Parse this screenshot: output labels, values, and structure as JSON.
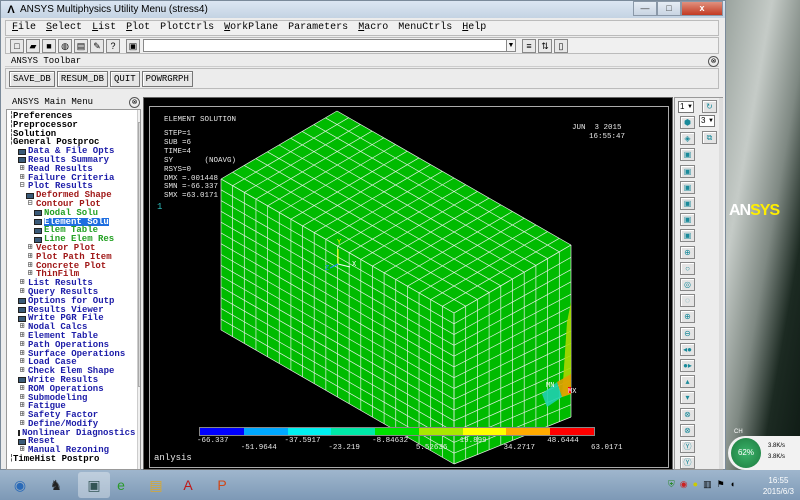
{
  "window": {
    "title": "ANSYS Multiphysics Utility Menu (stress4)",
    "minimize": "—",
    "maximize": "□",
    "close": "x"
  },
  "menu": [
    {
      "k": "F",
      "r": "ile"
    },
    {
      "k": "S",
      "r": "elect"
    },
    {
      "k": "L",
      "r": "ist"
    },
    {
      "k": "P",
      "r": "lot"
    },
    {
      "k": "",
      "r": "PlotCtrls"
    },
    {
      "k": "W",
      "r": "orkPlane"
    },
    {
      "k": "",
      "r": "Parameters"
    },
    {
      "k": "M",
      "r": "acro"
    },
    {
      "k": "",
      "r": "MenuCtrls"
    },
    {
      "k": "H",
      "r": "elp"
    }
  ],
  "toolbar_icons": [
    "new-file",
    "open-folder",
    "save",
    "report",
    "print",
    "snapshot",
    "help-hint"
  ],
  "command_input": {
    "value": ""
  },
  "ansys_toolbar": {
    "label": "ANSYS Toolbar",
    "buttons": [
      "SAVE_DB",
      "RESUM_DB",
      "QUIT",
      "POWRGRPH"
    ]
  },
  "main_menu": {
    "title": "ANSYS Main Menu",
    "items": [
      {
        "l": 0,
        "p": "▪",
        "t": "Preferences"
      },
      {
        "l": 0,
        "p": "▪",
        "t": "Preprocessor"
      },
      {
        "l": 0,
        "p": "▪",
        "t": "Solution"
      },
      {
        "l": 0,
        "p": "▪",
        "t": "General Postproc"
      },
      {
        "l": 1,
        "p": "i",
        "t": "Data & File Opts"
      },
      {
        "l": 1,
        "p": "i",
        "t": "Results Summary"
      },
      {
        "l": 1,
        "p": "⊞",
        "t": "Read Results"
      },
      {
        "l": 1,
        "p": "⊞",
        "t": "Failure Criteria"
      },
      {
        "l": 1,
        "p": "⊟",
        "t": "Plot Results"
      },
      {
        "l": 2,
        "p": "i",
        "t": "Deformed Shape"
      },
      {
        "l": 2,
        "p": "⊟",
        "t": "Contour Plot"
      },
      {
        "l": 3,
        "p": "i",
        "t": "Nodal Solu"
      },
      {
        "l": 3,
        "p": "i",
        "t": "Element Solu",
        "sel": true
      },
      {
        "l": 3,
        "p": "i",
        "t": "Elem Table"
      },
      {
        "l": 3,
        "p": "i",
        "t": "Line Elem Res"
      },
      {
        "l": 2,
        "p": "⊞",
        "t": "Vector Plot"
      },
      {
        "l": 2,
        "p": "⊞",
        "t": "Plot Path Item"
      },
      {
        "l": 2,
        "p": "⊞",
        "t": "Concrete Plot"
      },
      {
        "l": 2,
        "p": "⊞",
        "t": "ThinFilm"
      },
      {
        "l": 1,
        "p": "⊞",
        "t": "List Results"
      },
      {
        "l": 1,
        "p": "⊞",
        "t": "Query Results"
      },
      {
        "l": 1,
        "p": "i",
        "t": "Options for Outp"
      },
      {
        "l": 1,
        "p": "i",
        "t": "Results Viewer"
      },
      {
        "l": 1,
        "p": "i",
        "t": "Write PGR File"
      },
      {
        "l": 1,
        "p": "⊞",
        "t": "Nodal Calcs"
      },
      {
        "l": 1,
        "p": "⊞",
        "t": "Element Table"
      },
      {
        "l": 1,
        "p": "⊞",
        "t": "Path Operations"
      },
      {
        "l": 1,
        "p": "⊞",
        "t": "Surface Operations"
      },
      {
        "l": 1,
        "p": "⊞",
        "t": "Load Case"
      },
      {
        "l": 1,
        "p": "⊞",
        "t": "Check Elem Shape"
      },
      {
        "l": 1,
        "p": "i",
        "t": "Write Results"
      },
      {
        "l": 1,
        "p": "⊞",
        "t": "ROM Operations"
      },
      {
        "l": 1,
        "p": "⊞",
        "t": "Submodeling"
      },
      {
        "l": 1,
        "p": "⊞",
        "t": "Fatigue"
      },
      {
        "l": 1,
        "p": "⊞",
        "t": "Safety Factor"
      },
      {
        "l": 1,
        "p": "⊞",
        "t": "Define/Modify"
      },
      {
        "l": 1,
        "p": "i",
        "t": "Nonlinear Diagnostics"
      },
      {
        "l": 1,
        "p": "i",
        "t": "Reset"
      },
      {
        "l": 1,
        "p": "⊞",
        "t": "Manual Rezoning"
      },
      {
        "l": 0,
        "p": "▪",
        "t": "TimeHist Postpro"
      }
    ]
  },
  "graphics": {
    "window_number": "1",
    "title": "ELEMENT SOLUTION",
    "info": [
      "STEP=1",
      "SUB =6",
      "TIME=4",
      "SY       (NOAVG)",
      "RSYS=0",
      "DMX =.001448",
      "SMN =-66.337",
      "SMX =63.0171"
    ],
    "logo_a": "AN",
    "logo_b": "SYS",
    "date": "JUN  3 2015",
    "time": "16:55:47",
    "label_mn": "MN",
    "label_mx": "MX",
    "axis_y": "Y",
    "axis_x": "X",
    "axis_z": "Z",
    "footer": "anlysis",
    "legend_colors": [
      "#0000ff",
      "#00a8ff",
      "#00f0f0",
      "#00e8a8",
      "#00e000",
      "#a8e800",
      "#ffff00",
      "#ffaa00",
      "#ff0000"
    ],
    "legend_values": [
      "-66.337",
      "-51.9644",
      "-37.5917",
      "-23.219",
      "-8.84632",
      "5.52636",
      "19.899",
      "34.2717",
      "48.6444",
      "63.0171"
    ],
    "colors": {
      "mesh_fill": "#00bb00",
      "mesh_line": "#e0f0e0",
      "logo_a": "#ffffff",
      "logo_b": "#ffee00"
    }
  },
  "right_panel": {
    "window_select": "1",
    "view_select": "3",
    "buttons": [
      "replot",
      "isometric-view",
      "oblique-view",
      "front-view",
      "back-view",
      "top-view",
      "bottom-view",
      "left-view",
      "right-view",
      "zoom",
      "box-zoom",
      "win-zoom",
      "back-up-zoom",
      "zoom-in",
      "zoom-out",
      "pan-left",
      "pan-right",
      "pan-up",
      "pan-down",
      "rotate-x",
      "rotate-x-neg",
      "rotate-y",
      "rotate-y-neg",
      "rotate-z"
    ]
  },
  "taskbar": {
    "apps": [
      "start",
      "qq",
      "ansys",
      "ie",
      "explorer",
      "acrobat",
      "powerpoint"
    ],
    "time": "16:55",
    "date": "2015/6/3"
  },
  "network": {
    "percent": "62%",
    "up": "3.8K/s",
    "down": "3.8K/s",
    "ime": "CH"
  }
}
